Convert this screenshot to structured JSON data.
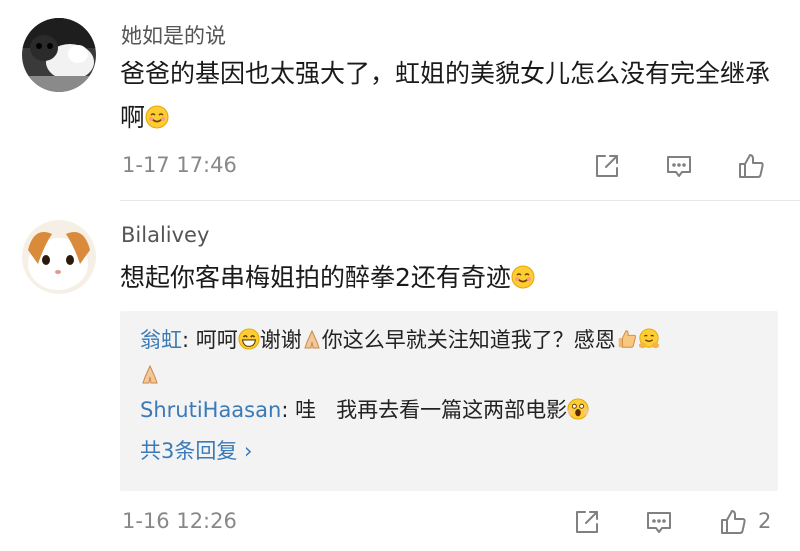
{
  "comments": [
    {
      "username": "她如是的说",
      "text": "爸爸的基因也太强大了，虹姐的美貌女儿怎么没有完全继承啊",
      "time": "1-17 17:46"
    },
    {
      "username": "Bilalivey",
      "text": "想起你客串梅姐拍的醉拳2还有奇迹",
      "time": "1-16 12:26",
      "like_count": "2",
      "replies": [
        {
          "name": "翁虹",
          "sep": ": ",
          "segments": [
            "呵呵",
            "谢谢",
            "你这么早就关注知道我了？感恩"
          ]
        },
        {
          "name": "ShrutiHaasan",
          "sep": ": ",
          "text": "哇   我再去看一篇这两部电影"
        }
      ],
      "more_replies": "共3条回复 ›"
    }
  ],
  "icons": [
    "share-icon",
    "comment-icon",
    "like-icon",
    "grin-emoji",
    "praying-hands-emoji",
    "thumbs-up-emoji",
    "hug-emoji",
    "smile-emoji",
    "scream-emoji"
  ],
  "colors": {
    "link": "#3a7ab8",
    "meta": "#888888",
    "reply_bg": "#f3f3f3"
  }
}
